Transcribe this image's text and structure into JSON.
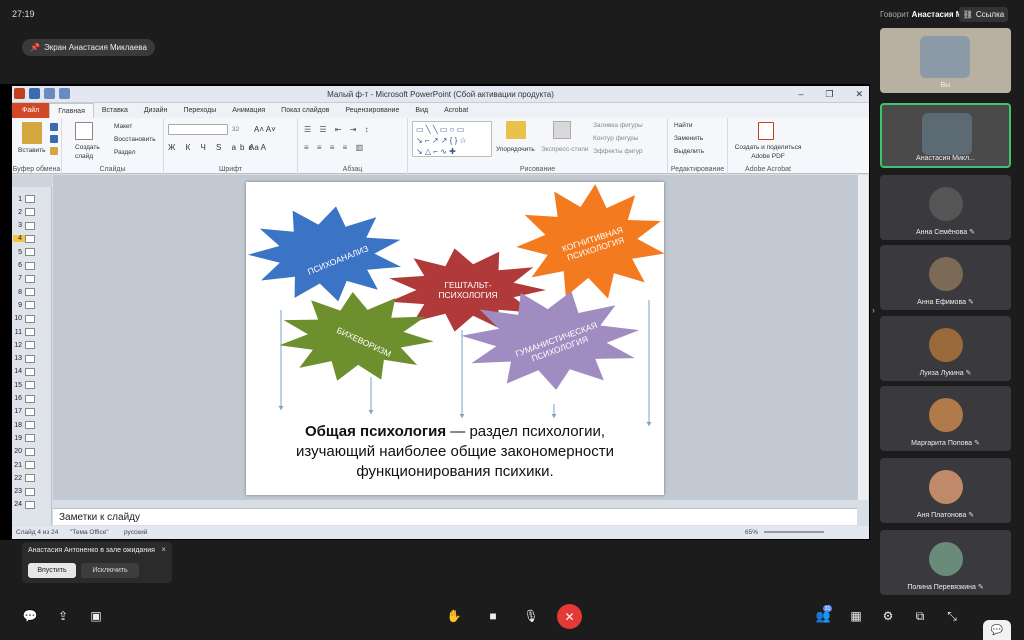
{
  "top": {
    "time": "27:19",
    "speaking_prefix": "Говорит",
    "speaking_name": "Анастасия М.",
    "link_label": "Ссылка",
    "screen_share_label": "Экран Анастасия Миклаева"
  },
  "ppt": {
    "window_title": "Малый ф-т - Microsoft PowerPoint (Сбой активации продукта)",
    "tabs": [
      "Файл",
      "Главная",
      "Вставка",
      "Дизайн",
      "Переходы",
      "Анимация",
      "Показ слайдов",
      "Рецензирование",
      "Вид",
      "Acrobat"
    ],
    "groups": {
      "clipboard": "Буфер обмена",
      "slides": "Слайды",
      "font": "Шрифт",
      "paragraph": "Абзац",
      "drawing": "Рисование",
      "editing": "Редактирование",
      "acrobat": "Adobe Acrobat"
    },
    "ribbon_labels": {
      "paste": "Вставить",
      "create_slide": "Создать\nслайд",
      "layout": "Макет",
      "restore": "Восстановить",
      "section": "Раздел",
      "font_size": "32",
      "arrange": "Упорядочить",
      "quick_styles": "Экспресс-стили",
      "fill": "Заливка фигуры",
      "outline": "Контур фигуры",
      "effects": "Эффекты фигур",
      "find": "Найти",
      "replace": "Заменить",
      "select": "Выделить",
      "create_pdf": "Создать и поделиться\nAdobe PDF"
    },
    "thumb_numbers": [
      "1",
      "2",
      "3",
      "4",
      "5",
      "6",
      "7",
      "8",
      "9",
      "10",
      "11",
      "12",
      "13",
      "14",
      "15",
      "16",
      "17",
      "18",
      "19",
      "20",
      "21",
      "22",
      "23",
      "24"
    ],
    "selected_slide": "4",
    "slide": {
      "shapes": [
        {
          "label": "ПСИХОАНАЛИЗ",
          "color": "#3b74c4"
        },
        {
          "label": "КОГНИТИВНАЯ\nПСИХОЛОГИЯ",
          "color": "#f47a20"
        },
        {
          "label": "ГЕШТАЛЬТ-\nПСИХОЛОГИЯ",
          "color": "#b03a3a"
        },
        {
          "label": "БИХЕВОРИЗМ",
          "color": "#6e8f2e"
        },
        {
          "label": "ГУМАНИСТИЧЕСКАЯ\nПСИХОЛОГИЯ",
          "color": "#a08cc0"
        }
      ],
      "text_bold": "Общая психология",
      "text_rest_1": " — раздел психологии,",
      "text_line2": "изучающий наиболее общие закономерности",
      "text_line3": "функционирования психики."
    },
    "notes_placeholder": "Заметки к слайду",
    "status_slide": "Слайд 4 из 24",
    "status_theme": "\"Тема Office\"",
    "status_lang": "русский",
    "status_zoom": "65%"
  },
  "participants": [
    {
      "name": "Вы",
      "color": "#8a9aa6"
    },
    {
      "name": "Анастасия Микл...",
      "color": "#5c6a74"
    },
    {
      "name": "Анна Семёнова",
      "color": "#555"
    },
    {
      "name": "Анна Ефимова",
      "color": "#7b6a55"
    },
    {
      "name": "Луиза Лукина",
      "color": "#9a6a3a"
    },
    {
      "name": "Маргарита Попова",
      "color": "#b07a4a"
    },
    {
      "name": "Аня Платонова",
      "color": "#c08a6a"
    },
    {
      "name": "Полина Перевязкина",
      "color": "#6a8a7a"
    }
  ],
  "toast": {
    "message": "Анастасия Антоненко в зале ожидания",
    "admit": "Впустить",
    "exclude": "Исключить"
  },
  "toolbar": {
    "participants_count": "31"
  }
}
